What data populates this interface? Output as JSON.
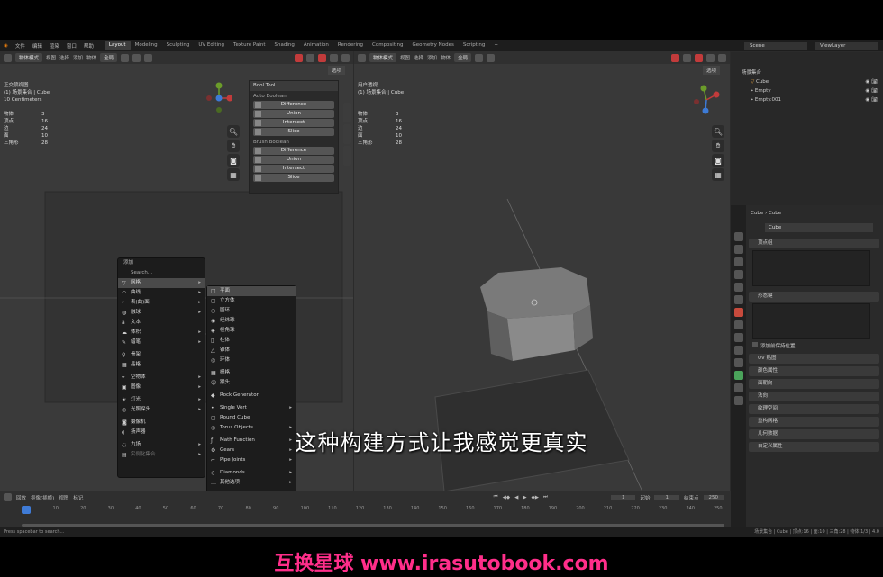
{
  "menubar": {
    "items": [
      "文件",
      "编辑",
      "渲染",
      "窗口",
      "帮助"
    ],
    "workspaces": [
      "Layout",
      "Modeling",
      "Sculpting",
      "UV Editing",
      "Texture Paint",
      "Shading",
      "Animation",
      "Rendering",
      "Compositing",
      "Geometry Nodes",
      "Scripting"
    ],
    "active_workspace": "Layout",
    "add_tab": "+",
    "scene": "Scene",
    "view_layer": "ViewLayer"
  },
  "left_viewport": {
    "header_mode": "物体模式",
    "header_items": [
      "视图",
      "选择",
      "添加",
      "物体"
    ],
    "global": "全局",
    "options": "选项",
    "view_name": "正交顶视图",
    "collection": "(1) 场景集合 | Cube",
    "units": "10 Centimeters",
    "stats": [
      {
        "label": "物体",
        "value": "3"
      },
      {
        "label": "顶点",
        "value": "16"
      },
      {
        "label": "边",
        "value": "24"
      },
      {
        "label": "面",
        "value": "10"
      },
      {
        "label": "三角形",
        "value": "28"
      }
    ]
  },
  "bool_panel": {
    "title": "Bool Tool",
    "auto_section": "Auto Boolean",
    "auto_buttons": [
      "Difference",
      "Union",
      "Intersect",
      "Slice"
    ],
    "brush_section": "Brush Boolean",
    "brush_buttons": [
      "Difference",
      "Union",
      "Intersect",
      "Slice"
    ]
  },
  "right_viewport": {
    "header_mode": "物体模式",
    "header_items": [
      "视图",
      "选择",
      "添加",
      "物体"
    ],
    "global": "全局",
    "options": "选项",
    "view_name": "用户透视",
    "collection": "(1) 场景集合 | Cube",
    "stats": [
      {
        "label": "物体",
        "value": "3"
      },
      {
        "label": "顶点",
        "value": "16"
      },
      {
        "label": "边",
        "value": "24"
      },
      {
        "label": "面",
        "value": "10"
      },
      {
        "label": "三角形",
        "value": "28"
      }
    ]
  },
  "add_menu": {
    "title": "添加",
    "search": "Search...",
    "items": [
      {
        "label": "网格",
        "icon": "▽",
        "submenu": true,
        "highlighted": true
      },
      {
        "label": "曲线",
        "icon": "◠",
        "submenu": true
      },
      {
        "label": "表(曲)面",
        "icon": "◜",
        "submenu": true
      },
      {
        "label": "融球",
        "icon": "◍",
        "submenu": true
      },
      {
        "label": "文本",
        "icon": "a",
        "submenu": false
      },
      {
        "label": "体积",
        "icon": "☁",
        "submenu": true
      },
      {
        "label": "蜡笔",
        "icon": "✎",
        "submenu": true
      },
      {
        "label": "骨架",
        "icon": "⚲",
        "submenu": false
      },
      {
        "label": "晶格",
        "icon": "▦",
        "submenu": false
      },
      {
        "label": "空物体",
        "icon": "⌖",
        "submenu": true
      },
      {
        "label": "图像",
        "icon": "▣",
        "submenu": true
      },
      {
        "label": "灯光",
        "icon": "☀",
        "submenu": true
      },
      {
        "label": "光照探头",
        "icon": "◎",
        "submenu": true
      },
      {
        "label": "摄像机",
        "icon": "◙",
        "submenu": false
      },
      {
        "label": "扬声器",
        "icon": "◖",
        "submenu": false
      },
      {
        "label": "力场",
        "icon": "◌",
        "submenu": true
      },
      {
        "label": "实例化集合",
        "icon": "▤",
        "submenu": true
      }
    ]
  },
  "mesh_submenu": {
    "items": [
      {
        "label": "平面",
        "icon": "□",
        "highlighted": true
      },
      {
        "label": "立方体",
        "icon": "▢"
      },
      {
        "label": "圆环",
        "icon": "○"
      },
      {
        "label": "经纬球",
        "icon": "◉"
      },
      {
        "label": "棱角球",
        "icon": "◈"
      },
      {
        "label": "柱体",
        "icon": "▯"
      },
      {
        "label": "锥体",
        "icon": "△"
      },
      {
        "label": "环体",
        "icon": "◎"
      },
      {
        "label": "栅格",
        "icon": "▦"
      },
      {
        "label": "猴头",
        "icon": "☺"
      },
      {
        "label": "Rock Generator",
        "icon": "◆"
      },
      {
        "label": "Single Vert",
        "icon": "•",
        "submenu": true
      },
      {
        "label": "Round Cube",
        "icon": "▢"
      },
      {
        "label": "Torus Objects",
        "icon": "◎",
        "submenu": true
      },
      {
        "label": "Math Function",
        "icon": "ƒ",
        "submenu": true
      },
      {
        "label": "Gears",
        "icon": "⚙",
        "submenu": true
      },
      {
        "label": "Pipe Joints",
        "icon": "⌐",
        "submenu": true
      },
      {
        "label": "Diamonds",
        "icon": "◇",
        "submenu": true
      },
      {
        "label": "其他选项",
        "icon": "…",
        "submenu": true
      },
      {
        "label": "Extras",
        "icon": "+",
        "submenu": true
      }
    ]
  },
  "outliner": {
    "root": "场景集合",
    "rows": [
      "Cube",
      "Empty",
      "Empty.001"
    ]
  },
  "properties": {
    "breadcrumb": [
      "Cube",
      "Cube"
    ],
    "data_name": "Cube",
    "sections": [
      "顶点组",
      "形态键",
      "UV 贴图",
      "颜色属性",
      "面朝向",
      "法向",
      "纹理空间",
      "重构网格",
      "几何数据",
      "自定义属性"
    ],
    "checkbox": "添加前保持位置"
  },
  "timeline": {
    "header_items": [
      "回放",
      "抠像(插帧)",
      "视图",
      "标记"
    ],
    "current_frame": "1",
    "start_label": "起始",
    "start": "1",
    "end_label": "结束点",
    "end": "250",
    "ticks": [
      "0",
      "10",
      "20",
      "30",
      "40",
      "50",
      "60",
      "70",
      "80",
      "90",
      "100",
      "110",
      "120",
      "130",
      "140",
      "150",
      "160",
      "170",
      "180",
      "190",
      "200",
      "210",
      "220",
      "230",
      "240",
      "250"
    ]
  },
  "statusbar": {
    "left": "Press spacebar to search...",
    "right": "场景集合 | Cube | 顶点:16 | 面:10 | 三角:28 | 物体:1/3 | 4.0"
  },
  "subtitle": "这种构建方式让我感觉更真实",
  "watermark": "互换星球 www.irasutobook.com"
}
